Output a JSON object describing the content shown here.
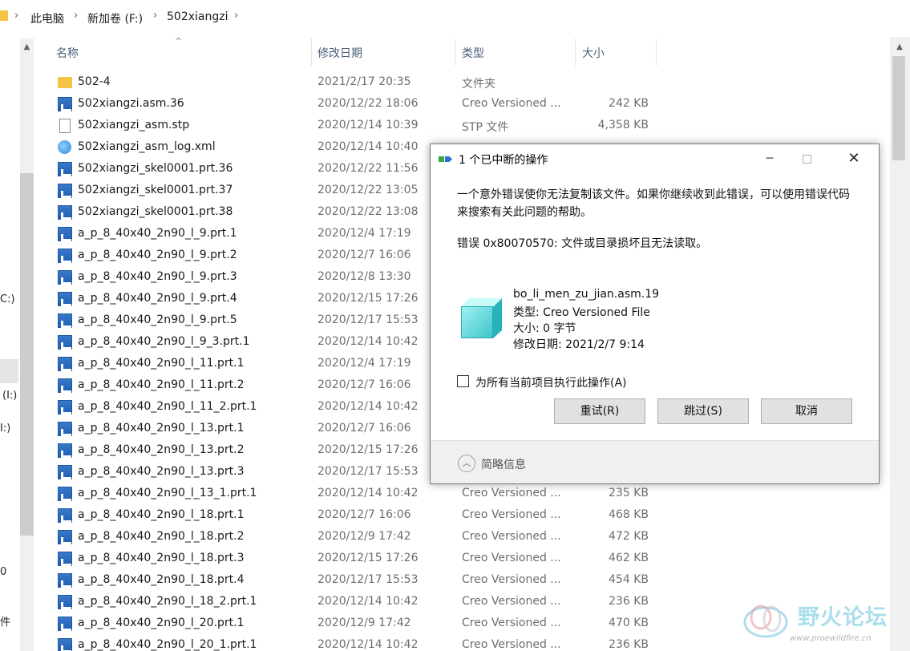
{
  "breadcrumb": {
    "items": [
      "此电脑",
      "新加卷 (F:)",
      "502xiangzi"
    ],
    "separator": "›"
  },
  "nav": {
    "fragments": [
      "C:)",
      "(I:)",
      "I:)",
      "0",
      "件"
    ]
  },
  "columns": {
    "name": "名称",
    "date": "修改日期",
    "type": "类型",
    "size": "大小"
  },
  "files": [
    {
      "name": "502-4",
      "date": "2021/2/17 20:35",
      "type": "文件夹",
      "size": "",
      "icon": "folder-icon"
    },
    {
      "name": "502xiangzi.asm.36",
      "date": "2020/12/22 18:06",
      "type": "Creo Versioned ...",
      "size": "242 KB",
      "icon": "creo-file-icon"
    },
    {
      "name": "502xiangzi_asm.stp",
      "date": "2020/12/14 10:39",
      "type": "STP 文件",
      "size": "4,358 KB",
      "icon": "document-icon"
    },
    {
      "name": "502xiangzi_asm_log.xml",
      "date": "2020/12/14 10:40",
      "type": "",
      "size": "",
      "icon": "xml-file-icon"
    },
    {
      "name": "502xiangzi_skel0001.prt.36",
      "date": "2020/12/22 11:56",
      "type": "",
      "size": "",
      "icon": "creo-file-icon"
    },
    {
      "name": "502xiangzi_skel0001.prt.37",
      "date": "2020/12/22 13:05",
      "type": "",
      "size": "",
      "icon": "creo-file-icon"
    },
    {
      "name": "502xiangzi_skel0001.prt.38",
      "date": "2020/12/22 13:08",
      "type": "",
      "size": "",
      "icon": "creo-file-icon"
    },
    {
      "name": "a_p_8_40x40_2n90_l_9.prt.1",
      "date": "2020/12/4 17:19",
      "type": "",
      "size": "",
      "icon": "creo-file-icon"
    },
    {
      "name": "a_p_8_40x40_2n90_l_9.prt.2",
      "date": "2020/12/7 16:06",
      "type": "",
      "size": "",
      "icon": "creo-file-icon"
    },
    {
      "name": "a_p_8_40x40_2n90_l_9.prt.3",
      "date": "2020/12/8 13:30",
      "type": "",
      "size": "",
      "icon": "creo-file-icon"
    },
    {
      "name": "a_p_8_40x40_2n90_l_9.prt.4",
      "date": "2020/12/15 17:26",
      "type": "",
      "size": "",
      "icon": "creo-file-icon"
    },
    {
      "name": "a_p_8_40x40_2n90_l_9.prt.5",
      "date": "2020/12/17 15:53",
      "type": "",
      "size": "",
      "icon": "creo-file-icon"
    },
    {
      "name": "a_p_8_40x40_2n90_l_9_3.prt.1",
      "date": "2020/12/14 10:42",
      "type": "",
      "size": "",
      "icon": "creo-file-icon"
    },
    {
      "name": "a_p_8_40x40_2n90_l_11.prt.1",
      "date": "2020/12/4 17:19",
      "type": "",
      "size": "",
      "icon": "creo-file-icon"
    },
    {
      "name": "a_p_8_40x40_2n90_l_11.prt.2",
      "date": "2020/12/7 16:06",
      "type": "",
      "size": "",
      "icon": "creo-file-icon"
    },
    {
      "name": "a_p_8_40x40_2n90_l_11_2.prt.1",
      "date": "2020/12/14 10:42",
      "type": "",
      "size": "",
      "icon": "creo-file-icon"
    },
    {
      "name": "a_p_8_40x40_2n90_l_13.prt.1",
      "date": "2020/12/7 16:06",
      "type": "",
      "size": "",
      "icon": "creo-file-icon"
    },
    {
      "name": "a_p_8_40x40_2n90_l_13.prt.2",
      "date": "2020/12/15 17:26",
      "type": "",
      "size": "",
      "icon": "creo-file-icon"
    },
    {
      "name": "a_p_8_40x40_2n90_l_13.prt.3",
      "date": "2020/12/17 15:53",
      "type": "",
      "size": "",
      "icon": "creo-file-icon"
    },
    {
      "name": "a_p_8_40x40_2n90_l_13_1.prt.1",
      "date": "2020/12/14 10:42",
      "type": "Creo Versioned ...",
      "size": "235 KB",
      "icon": "creo-file-icon"
    },
    {
      "name": "a_p_8_40x40_2n90_l_18.prt.1",
      "date": "2020/12/7 16:06",
      "type": "Creo Versioned ...",
      "size": "468 KB",
      "icon": "creo-file-icon"
    },
    {
      "name": "a_p_8_40x40_2n90_l_18.prt.2",
      "date": "2020/12/9 17:42",
      "type": "Creo Versioned ...",
      "size": "472 KB",
      "icon": "creo-file-icon"
    },
    {
      "name": "a_p_8_40x40_2n90_l_18.prt.3",
      "date": "2020/12/15 17:26",
      "type": "Creo Versioned ...",
      "size": "462 KB",
      "icon": "creo-file-icon"
    },
    {
      "name": "a_p_8_40x40_2n90_l_18.prt.4",
      "date": "2020/12/17 15:53",
      "type": "Creo Versioned ...",
      "size": "454 KB",
      "icon": "creo-file-icon"
    },
    {
      "name": "a_p_8_40x40_2n90_l_18_2.prt.1",
      "date": "2020/12/14 10:42",
      "type": "Creo Versioned ...",
      "size": "236 KB",
      "icon": "creo-file-icon"
    },
    {
      "name": "a_p_8_40x40_2n90_l_20.prt.1",
      "date": "2020/12/9 17:42",
      "type": "Creo Versioned ...",
      "size": "470 KB",
      "icon": "creo-file-icon"
    },
    {
      "name": "a_p_8_40x40_2n90_l_20_1.prt.1",
      "date": "2020/12/14 10:42",
      "type": "Creo Versioned ...",
      "size": "236 KB",
      "icon": "creo-file-icon"
    }
  ],
  "dialog": {
    "title": "1 个已中断的操作",
    "message": "一个意外错误使你无法复制该文件。如果你继续收到此错误，可以使用错误代码来搜索有关此问题的帮助。",
    "error": "错误 0x80070570: 文件或目录损坏且无法读取。",
    "file_name": "bo_li_men_zu_jian.asm.19",
    "file_type": "类型: Creo Versioned File",
    "file_size": "大小: 0 字节",
    "file_modified": "修改日期: 2021/2/7 9:14",
    "checkbox_label": "为所有当前项目执行此操作(A)",
    "retry_label": "重试(R)",
    "skip_label": "跳过(S)",
    "cancel_label": "取消",
    "details_label": "简略信息"
  },
  "watermark": {
    "text": "野火论坛",
    "url": "www.proewildfire.cn"
  }
}
